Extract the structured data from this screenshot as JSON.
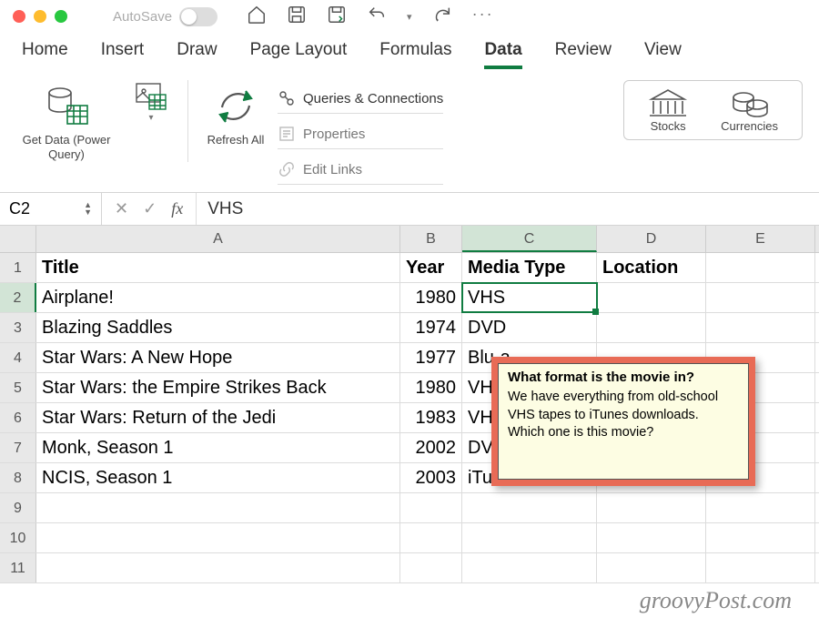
{
  "titlebar": {
    "autosave_label": "AutoSave"
  },
  "tabs": [
    "Home",
    "Insert",
    "Draw",
    "Page Layout",
    "Formulas",
    "Data",
    "Review",
    "View"
  ],
  "active_tab": "Data",
  "ribbon": {
    "get_data": "Get Data (Power Query)",
    "refresh": "Refresh All",
    "queries": "Queries & Connections",
    "properties": "Properties",
    "edit_links": "Edit Links",
    "stocks": "Stocks",
    "currencies": "Currencies"
  },
  "formula_bar": {
    "name_box": "C2",
    "value": "VHS"
  },
  "columns": [
    "A",
    "B",
    "C",
    "D",
    "E"
  ],
  "headers": {
    "title": "Title",
    "year": "Year",
    "media": "Media Type",
    "location": "Location"
  },
  "rows": [
    {
      "title": "Airplane!",
      "year": 1980,
      "media": "VHS"
    },
    {
      "title": "Blazing Saddles",
      "year": 1974,
      "media": "DVD"
    },
    {
      "title": "Star Wars: A New Hope",
      "year": 1977,
      "media": "Blu-a"
    },
    {
      "title": "Star Wars: the Empire Strikes Back",
      "year": 1980,
      "media": "VHS"
    },
    {
      "title": "Star Wars: Return of the Jedi",
      "year": 1983,
      "media": "VHS"
    },
    {
      "title": "Monk, Season 1",
      "year": 2002,
      "media": "DVD"
    },
    {
      "title": "NCIS, Season 1",
      "year": 2003,
      "media": "iTunes"
    }
  ],
  "selected_cell": "C2",
  "tooltip": {
    "title": "What format is the movie in?",
    "body": "We have everything from old-school VHS tapes to iTunes downloads. Which one is this movie?"
  },
  "watermark": "groovyPost.com"
}
